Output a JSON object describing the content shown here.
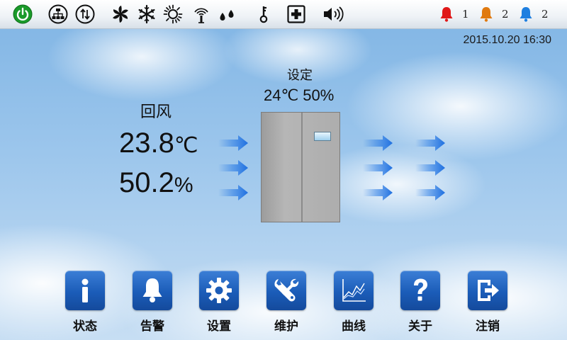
{
  "status_bar": {
    "icons": [
      "power-icon",
      "network-icon",
      "transfer-icon",
      "fan-icon",
      "snowflake-icon",
      "sun-icon",
      "wireless-icon",
      "water-drops-icon",
      "key-icon",
      "medical-cross-icon",
      "speaker-icon"
    ],
    "alarms": [
      {
        "level": "critical",
        "color": "#e01818",
        "count": "1"
      },
      {
        "level": "major",
        "color": "#e07a10",
        "count": "2"
      },
      {
        "level": "minor",
        "color": "#1e7fe0",
        "count": "2"
      }
    ]
  },
  "datetime": "2015.10.20 16:30",
  "return_air": {
    "label": "回风",
    "temperature": "23.8",
    "temperature_unit": "℃",
    "humidity": "50.2",
    "humidity_unit": "%"
  },
  "setpoint": {
    "label": "设定",
    "values": "24℃ 50%"
  },
  "nav": [
    {
      "label": "状态",
      "icon": "info-icon"
    },
    {
      "label": "告警",
      "icon": "bell-icon"
    },
    {
      "label": "设置",
      "icon": "gear-icon"
    },
    {
      "label": "维护",
      "icon": "wrench-icon"
    },
    {
      "label": "曲线",
      "icon": "line-chart-icon"
    },
    {
      "label": "关于",
      "icon": "question-icon"
    },
    {
      "label": "注销",
      "icon": "logout-icon"
    }
  ],
  "colors": {
    "accent_blue": "#1b5cb8",
    "power_green": "#1a9a2a",
    "arrow_blue": "#2f7fe6"
  }
}
